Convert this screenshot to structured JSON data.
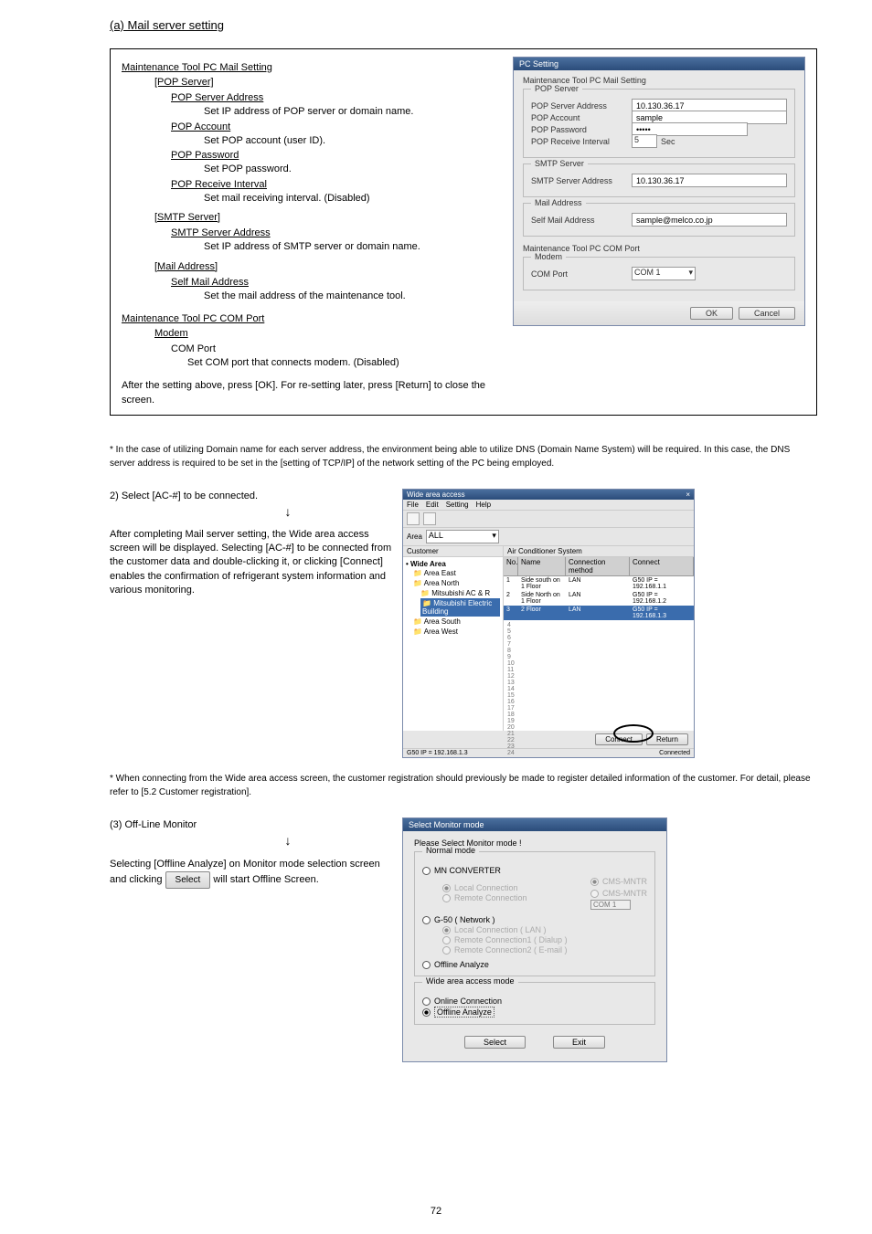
{
  "page_number": "72",
  "section_title": "(a) Mail server setting",
  "box": {
    "h1": "Maintenance Tool PC Mail Setting",
    "p1": "[POP Server]",
    "pop_server_desc1": "POP Server Address",
    "pop_server_desc1b": "Set IP address of POP server or domain name.",
    "pop_account": "POP Account",
    "pop_account_desc": "Set POP account (user ID).",
    "pop_password": "POP Password",
    "pop_password_desc": "Set POP password.",
    "pop_interval": "POP Receive Interval",
    "pop_interval_desc": "Set mail receiving interval. (Disabled)",
    "p2": "[SMTP Server]",
    "smtp_server": "SMTP Server Address",
    "smtp_server_desc": "Set IP address of SMTP server or domain name.",
    "p3": "[Mail Address]",
    "self_mail": "Self Mail Address",
    "self_mail_desc": "Set the mail address of the maintenance tool.",
    "h2": "Maintenance Tool PC COM Port",
    "modem": "Modem",
    "modem_com": "COM Port",
    "modem_desc": "Set COM port that connects modem. (Disabled)",
    "note": "After the setting above, press [OK]. For re-setting later, press [Return] to close the screen."
  },
  "pc_settings_dialog": {
    "title": "PC Setting",
    "group1": "Maintenance Tool PC Mail Setting",
    "pop_server_legend": "POP Server",
    "lbl_pop_address": "POP Server Address",
    "val_pop_address": "10.130.36.17",
    "lbl_pop_account": "POP Account",
    "val_pop_account": "sample",
    "lbl_pop_password": "POP Password",
    "val_pop_password": "•••••",
    "lbl_pop_interval": "POP Receive Interval",
    "val_pop_interval": "5",
    "val_pop_interval_unit": "Sec",
    "smtp_legend": "SMTP Server",
    "lbl_smtp_address": "SMTP Server Address",
    "val_smtp_address": "10.130.36.17",
    "mail_legend": "Mail Address",
    "lbl_self_mail": "Self Mail Address",
    "val_self_mail": "sample@melco.co.jp",
    "group2": "Maintenance Tool PC COM Port",
    "modem_legend": "Modem",
    "lbl_com": "COM Port",
    "val_com": "COM 1",
    "btn_ok": "OK",
    "btn_cancel": "Cancel"
  },
  "note_block": "*  In the case of utilizing Domain name for each server address, the environment being able to utilize DNS (Domain Name System) will be required. In this case, the DNS server address is required to be set in the [setting of TCP/IP] of the network setting of the PC being employed.",
  "step2": {
    "p1": "2) Select [AC-#] to be connected.",
    "p2": "After completing Mail server setting, the Wide area access screen will be displayed. Selecting [AC-#] to be connected from the customer data and double-clicking it, or clicking [Connect] enables the confirmation of refrigerant system information and various monitoring."
  },
  "wa_screenshot": {
    "title": "Wide area access",
    "close": "×",
    "menu_file": "File",
    "menu_edit": "Edit",
    "menu_setting": "Setting",
    "menu_help": "Help",
    "area_lbl": "Area",
    "area_val": "ALL",
    "customer_hdr": "Customer",
    "ac_hdr": "Air Conditioner System",
    "tree_root": "• Wide Area",
    "tree1": "Area East",
    "tree2": "Area North",
    "tree2a": "Mitsubishi AC & R",
    "tree2b": "Mitsubishi Electric Building",
    "tree3": "Area South",
    "tree4": "Area West",
    "col_no": "No.",
    "col_name": "Name",
    "col_method": "Connection method",
    "col_connect": "Connect",
    "row1_no": "1",
    "row1_name": "Side south on 1 Floor",
    "row1_method": "LAN",
    "row1_conn": "G50 IP = 192.168.1.1",
    "row2_no": "2",
    "row2_name": "Side North on 1 Floor",
    "row2_method": "LAN",
    "row2_conn": "G50 IP = 192.168.1.2",
    "row3_no": "3",
    "row3_name": "2 Floor",
    "row3_method": "LAN",
    "row3_conn": "G50 IP = 192.168.1.3",
    "btn_connect": "Connect",
    "btn_return": "Return",
    "status_left": "G50 IP = 192.168.1.3",
    "status_right": "Connected"
  },
  "note_block2": "* When connecting from the Wide area access screen, the customer registration should previously be made to register detailed information of the customer. For detail, please refer to [5.2 Customer registration].",
  "step3": {
    "p1": "(3) Off-Line Monitor",
    "p2": "Selecting [Offline Analyze] on Monitor mode selection screen and clicking",
    "btn": "Select",
    "p3": " will start Offline Screen."
  },
  "sm_dialog": {
    "title": "Select Monitor mode",
    "prompt": "Please Select Monitor mode !",
    "group_normal": "Normal mode",
    "opt_mn": "MN CONVERTER",
    "sub_local": "Local Connection",
    "sub_remote": "Remote Connection",
    "sub_cms_imntr": "CMS-MNTR",
    "sub_cms_mntr": "CMS-MNTR",
    "combo": "COM 1",
    "opt_g50": "G-50 ( Network )",
    "sub_lan": "Local Connection  ( LAN )",
    "sub_dialup": "Remote Connection1 ( Dialup )",
    "sub_email": "Remote Connection2 ( E-mail )",
    "opt_offline": "Offline Analyze",
    "group_wide": "Wide area access mode",
    "opt_online": "Online Connection",
    "opt_offline2": "Offline Analyze",
    "btn_select": "Select",
    "btn_exit": "Exit"
  }
}
